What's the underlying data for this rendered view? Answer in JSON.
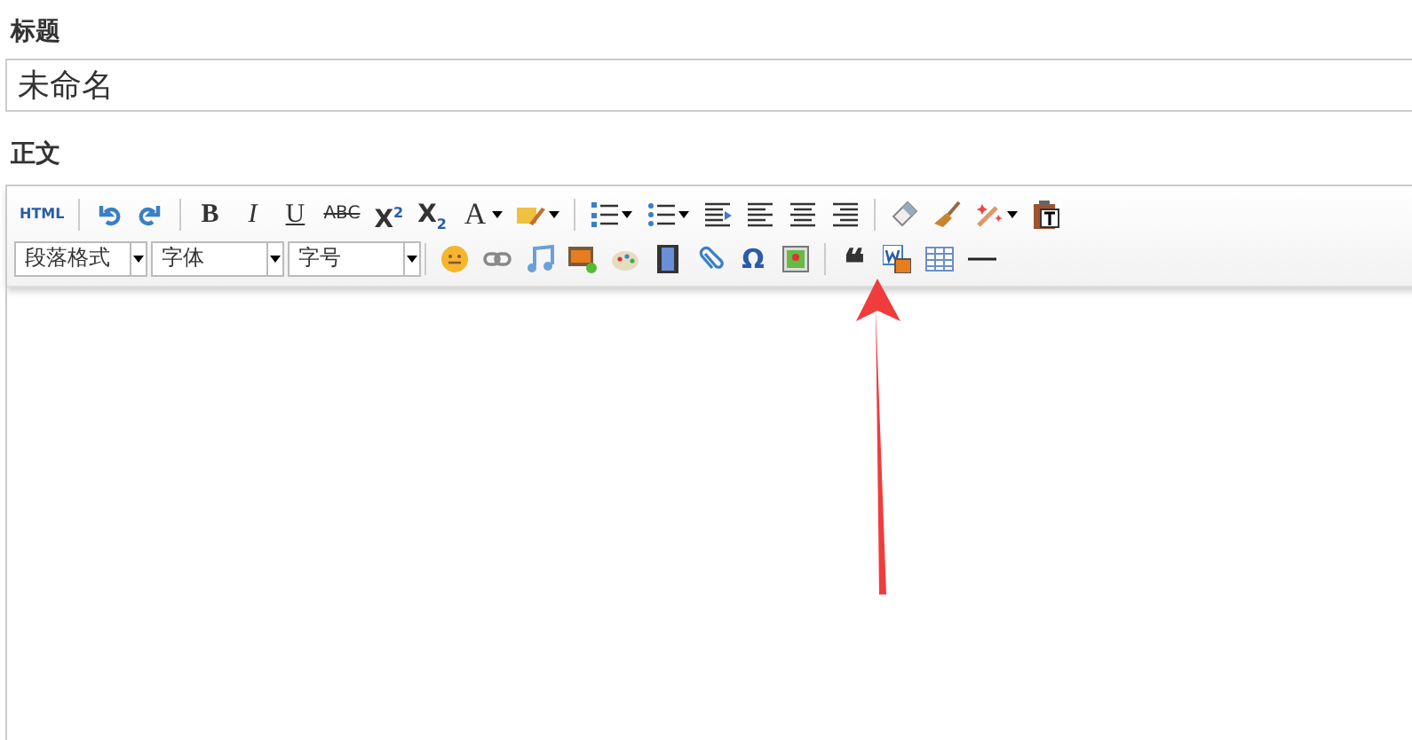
{
  "title_label": "标题",
  "title_field": {
    "value": "未命名"
  },
  "body_label": "正文",
  "toolbar": {
    "text_buttons": [
      "HTML",
      "B",
      "I",
      "U",
      "ABC",
      "X$^{2}$",
      "X$_{2}$",
      "A",
      "Ω",
      "❝"
    ],
    "selects": [
      "段落格式",
      "字体",
      "字号"
    ]
  }
}
